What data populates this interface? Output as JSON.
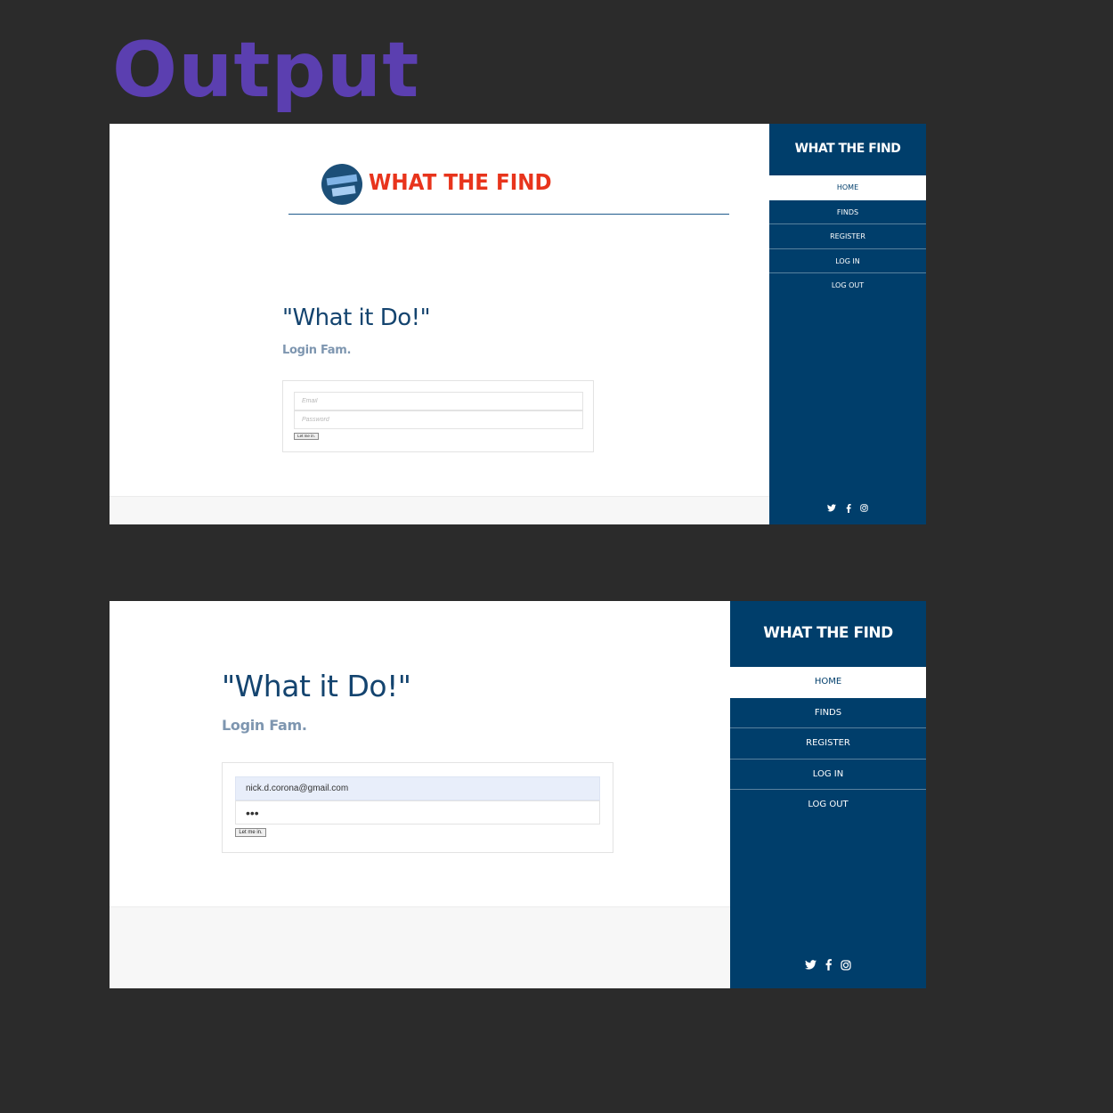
{
  "page_heading": "Output",
  "colors": {
    "background": "#2b2b2b",
    "heading": "#5b3fb0",
    "sidebar": "#003e6b",
    "title": "#14446f",
    "subtitle": "#7e96b0",
    "logo_text": "#e8341c"
  },
  "logo": {
    "text": "WHAT THE FIND",
    "badge_icon": "what-the-find-badge-icon"
  },
  "sidebar": {
    "brand": "WHAT THE FIND",
    "nav": [
      "HOME",
      "FINDS",
      "REGISTER",
      "LOG IN",
      "LOG OUT"
    ],
    "active_index": 0,
    "social_icons": [
      "twitter-icon",
      "facebook-icon",
      "instagram-icon"
    ]
  },
  "content": {
    "title": "\"What it Do!\"",
    "subtitle": "Login Fam.",
    "button_label": "Let me in."
  },
  "screenshot1": {
    "email_placeholder": "Email",
    "password_placeholder": "Password"
  },
  "screenshot2": {
    "email_value": "nick.d.corona@gmail.com",
    "password_value": "•••"
  }
}
